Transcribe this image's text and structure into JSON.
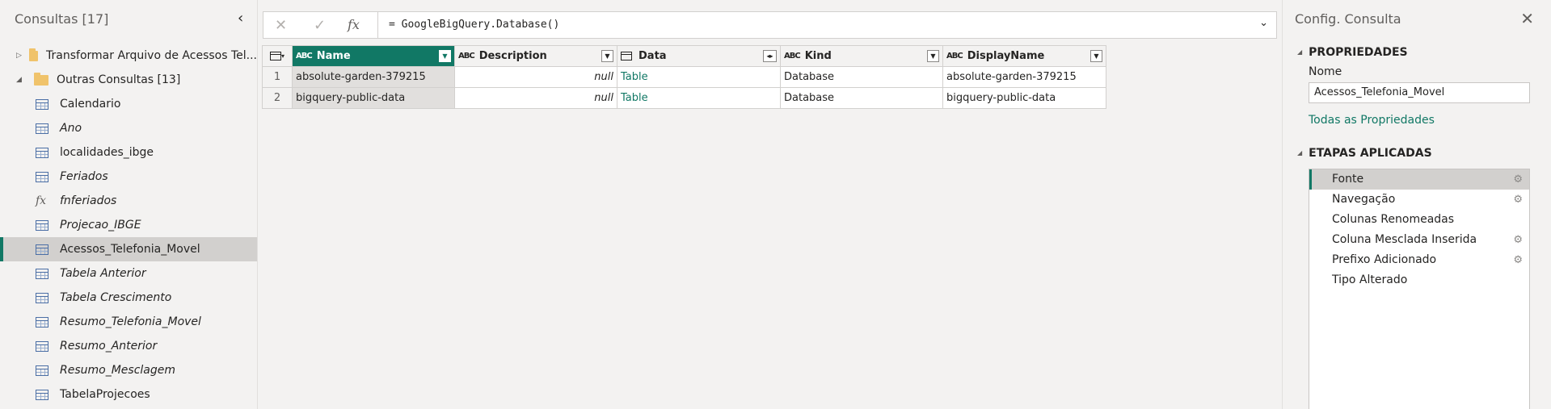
{
  "left": {
    "title": "Consultas [17]",
    "groups": [
      {
        "label": "Transformar Arquivo de Acessos Tel...",
        "expanded": false
      },
      {
        "label": "Outras Consultas [13]",
        "expanded": true
      }
    ],
    "queries": [
      {
        "label": "Calendario",
        "icon": "table-icon",
        "italic": false
      },
      {
        "label": "Ano",
        "icon": "table-icon",
        "italic": true
      },
      {
        "label": "localidades_ibge",
        "icon": "table-icon",
        "italic": false
      },
      {
        "label": "Feriados",
        "icon": "table-icon",
        "italic": true
      },
      {
        "label": "fnferiados",
        "icon": "fx-icon",
        "italic": true
      },
      {
        "label": "Projecao_IBGE",
        "icon": "table-icon",
        "italic": true
      },
      {
        "label": "Acessos_Telefonia_Movel",
        "icon": "table-icon",
        "italic": false,
        "selected": true
      },
      {
        "label": "Tabela Anterior",
        "icon": "table-icon",
        "italic": true
      },
      {
        "label": "Tabela Crescimento",
        "icon": "table-icon",
        "italic": true
      },
      {
        "label": "Resumo_Telefonia_Movel",
        "icon": "table-icon",
        "italic": true
      },
      {
        "label": "Resumo_Anterior",
        "icon": "table-icon",
        "italic": true
      },
      {
        "label": "Resumo_Mesclagem",
        "icon": "table-icon",
        "italic": true
      },
      {
        "label": "TabelaProjecoes",
        "icon": "table-icon",
        "italic": false
      }
    ]
  },
  "formula": {
    "cancel_icon": "✕",
    "commit_icon": "✓",
    "fx_label": "fx",
    "text": "= GoogleBigQuery.Database()"
  },
  "grid": {
    "columns": [
      {
        "name": "Name",
        "type": "ABC",
        "selected": true
      },
      {
        "name": "Description",
        "type": "ABC"
      },
      {
        "name": "Data",
        "type": "Table"
      },
      {
        "name": "Kind",
        "type": "ABC"
      },
      {
        "name": "DisplayName",
        "type": "ABC"
      }
    ],
    "rows": [
      {
        "num": "1",
        "Name": "absolute-garden-379215",
        "Description": "null",
        "Data": "Table",
        "Kind": "Database",
        "DisplayName": "absolute-garden-379215"
      },
      {
        "num": "2",
        "Name": "bigquery-public-data",
        "Description": "null",
        "Data": "Table",
        "Kind": "Database",
        "DisplayName": "bigquery-public-data"
      }
    ]
  },
  "right": {
    "title": "Config. Consulta",
    "properties_header": "PROPRIEDADES",
    "name_label": "Nome",
    "name_value": "Acessos_Telefonia_Movel",
    "all_props_link": "Todas as Propriedades",
    "steps_header": "ETAPAS APLICADAS",
    "steps": [
      {
        "label": "Fonte",
        "gear": true,
        "active": true
      },
      {
        "label": "Navegação",
        "gear": true
      },
      {
        "label": "Colunas Renomeadas",
        "gear": false
      },
      {
        "label": "Coluna Mesclada Inserida",
        "gear": true
      },
      {
        "label": "Prefixo Adicionado",
        "gear": true
      },
      {
        "label": "Tipo Alterado",
        "gear": false
      }
    ]
  },
  "colors": {
    "accent": "#117865",
    "selected_bg": "#d2d0ce"
  }
}
